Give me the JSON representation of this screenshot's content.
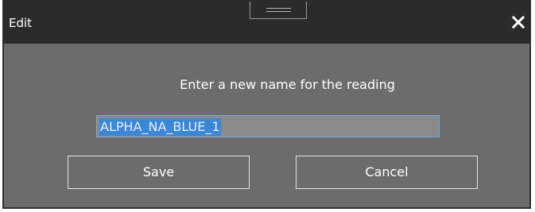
{
  "dialog": {
    "title": "Edit",
    "prompt": "Enter a new name for the reading",
    "input_value": "ALPHA_NA_BLUE_1",
    "save_label": "Save",
    "cancel_label": "Cancel"
  },
  "icons": {
    "close": "close-icon",
    "drag": "drag-handle-icon"
  },
  "colors": {
    "titlebar": "#2b2b2b",
    "body": "#6c6c6c",
    "selection": "#3b86d6",
    "input_border": "#79a7dc"
  }
}
